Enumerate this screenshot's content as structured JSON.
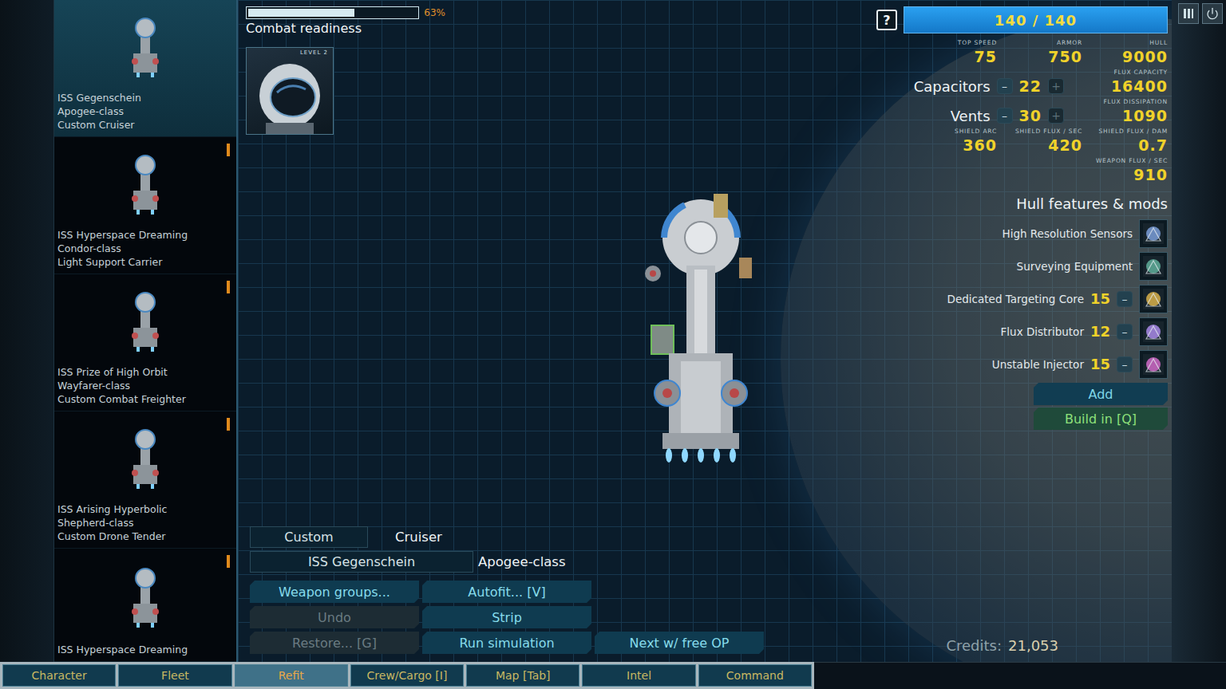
{
  "combat_readiness": {
    "label": "Combat readiness",
    "level": 0.63,
    "reading": "63%"
  },
  "officer": {
    "level_label": "LEVEL 2"
  },
  "hull_bar": {
    "help": "?",
    "reading": "140 / 140",
    "level": 1
  },
  "stat_rows": [
    {
      "kind": "stats",
      "items": [
        {
          "label": "TOP SPEED",
          "value": "75"
        },
        {
          "label": "ARMOR",
          "value": "750"
        },
        {
          "label": "HULL",
          "value": "9000"
        }
      ]
    },
    {
      "kind": "control",
      "label": "Capacitors",
      "minus": "–",
      "value": "22",
      "plus": "+",
      "minus_disabled": false,
      "plus_disabled": true,
      "stat": {
        "label": "FLUX CAPACITY",
        "value": "16400"
      }
    },
    {
      "kind": "control",
      "label": "Vents",
      "minus": "–",
      "value": "30",
      "plus": "+",
      "minus_disabled": false,
      "plus_disabled": true,
      "stat": {
        "label": "FLUX DISSIPATION",
        "value": "1090"
      }
    },
    {
      "kind": "stats",
      "items": [
        {
          "label": "SHIELD ARC",
          "value": "360"
        },
        {
          "label": "SHIELD FLUX / SEC",
          "value": "420"
        },
        {
          "label": "SHIELD FLUX / DAM",
          "value": "0.7"
        }
      ]
    },
    {
      "kind": "stats",
      "items": [
        {
          "label": "WEAPON FLUX / SEC",
          "value": "910"
        }
      ]
    }
  ],
  "features": {
    "heading": "Hull features & mods",
    "items": [
      {
        "name": "High Resolution Sensors"
      },
      {
        "name": "Surveying Equipment"
      },
      {
        "name": "Dedicated Targeting Core",
        "cost": "15",
        "remove": "–"
      },
      {
        "name": "Flux Distributor",
        "cost": "12",
        "remove": "–"
      },
      {
        "name": "Unstable Injector",
        "cost": "15",
        "remove": "–"
      }
    ],
    "buttons": [
      {
        "label": "Add",
        "kind": "default"
      },
      {
        "label": "Build in [Q]",
        "kind": "build"
      }
    ]
  },
  "ships": [
    {
      "lines": [
        "ISS Gegenschein",
        "Apogee-class",
        "Custom Cruiser"
      ],
      "selected": true,
      "flag": false
    },
    {
      "lines": [
        "ISS Hyperspace Dreaming",
        "Condor-class",
        "Light Support Carrier"
      ],
      "selected": false,
      "flag": true
    },
    {
      "lines": [
        "ISS Prize of High Orbit",
        "Wayfarer-class",
        "Custom Combat Freighter"
      ],
      "selected": false,
      "flag": true
    },
    {
      "lines": [
        "ISS Arising Hyperbolic",
        "Shepherd-class",
        "Custom Drone Tender"
      ],
      "selected": false,
      "flag": true
    },
    {
      "lines": [
        "ISS Hyperspace Dreaming"
      ],
      "selected": false,
      "flag": true
    }
  ],
  "info_rows": [
    {
      "field": "Custom",
      "value": "Cruiser"
    },
    {
      "field": "ISS Gegenschein",
      "value": "Apogee-class"
    }
  ],
  "action_rows": [
    [
      {
        "label": "Weapon groups...",
        "disabled": false
      },
      {
        "label": "Autofit... [V]",
        "disabled": false
      }
    ],
    [
      {
        "label": "Undo",
        "disabled": true
      },
      {
        "label": "Strip",
        "disabled": false
      }
    ],
    [
      {
        "label": "Restore... [G]",
        "disabled": true
      },
      {
        "label": "Run simulation",
        "disabled": false
      },
      {
        "label": "Next w/ free OP",
        "disabled": false
      }
    ]
  ],
  "credits": {
    "label": "Credits:",
    "value": "21,053"
  },
  "nav_tabs": [
    {
      "label": "Character",
      "selected": false
    },
    {
      "label": "Fleet",
      "selected": false
    },
    {
      "label": "Refit",
      "selected": true
    },
    {
      "label": "Crew/Cargo [I]",
      "selected": false
    },
    {
      "label": "Map [Tab]",
      "selected": false
    },
    {
      "label": "Intel",
      "selected": false
    },
    {
      "label": "Command",
      "selected": false
    }
  ]
}
